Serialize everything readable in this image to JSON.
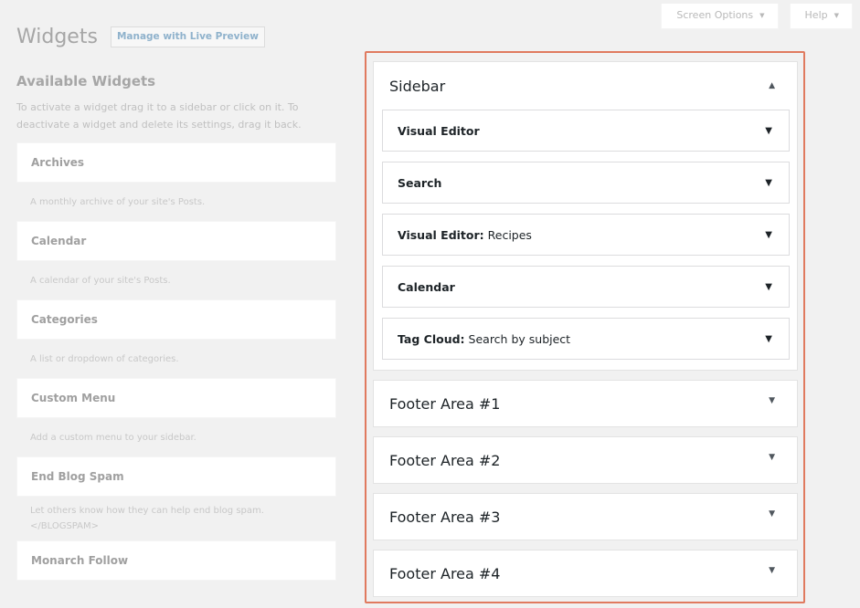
{
  "screen_meta": {
    "screen_options": "Screen Options",
    "help": "Help"
  },
  "header": {
    "title": "Widgets",
    "live_preview": "Manage with Live Preview"
  },
  "available": {
    "title": "Available Widgets",
    "description": "To activate a widget drag it to a sidebar or click on it. To deactivate a widget and delete its settings, drag it back.",
    "widgets": [
      {
        "name": "Archives",
        "desc": "A monthly archive of your site's Posts."
      },
      {
        "name": "Calendar",
        "desc": "A calendar of your site's Posts."
      },
      {
        "name": "Categories",
        "desc": "A list or dropdown of categories."
      },
      {
        "name": "Custom Menu",
        "desc": "Add a custom menu to your sidebar."
      },
      {
        "name": "End Blog Spam",
        "desc": "Let others know how they can help end blog spam. </BLOGSPAM>"
      },
      {
        "name": "Monarch Follow",
        "desc": ""
      }
    ]
  },
  "sidebars": {
    "primary": {
      "title": "Sidebar",
      "widgets": [
        {
          "name": "Visual Editor",
          "subtitle": ""
        },
        {
          "name": "Search",
          "subtitle": ""
        },
        {
          "name": "Visual Editor:",
          "subtitle": "Recipes"
        },
        {
          "name": "Calendar",
          "subtitle": ""
        },
        {
          "name": "Tag Cloud:",
          "subtitle": "Search by subject"
        }
      ]
    },
    "footers": [
      {
        "title": "Footer Area #1"
      },
      {
        "title": "Footer Area #2"
      },
      {
        "title": "Footer Area #3"
      },
      {
        "title": "Footer Area #4"
      }
    ]
  },
  "colors": {
    "highlight_border": "#e07a5f",
    "link": "#8fb2cc"
  },
  "icons": {
    "collapse": "triangle-up-icon",
    "expand": "triangle-down-icon"
  }
}
